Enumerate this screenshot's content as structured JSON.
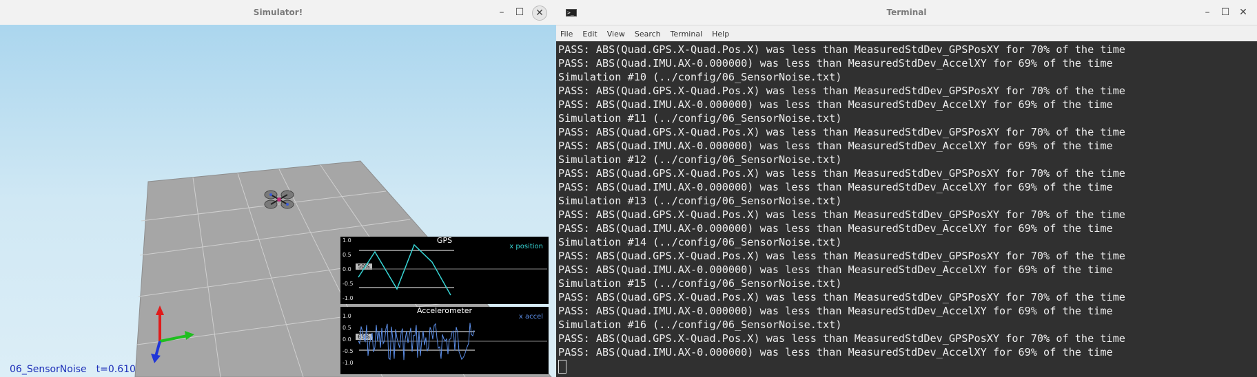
{
  "simulator": {
    "title": "Simulator!",
    "scenario_name": "06_SensorNoise",
    "time_label": "t=0.610",
    "gps_plot": {
      "title": "GPS",
      "legend": "x position",
      "legend_color": "#37d4d4",
      "badge": "50%",
      "yticks": [
        "1.0",
        "0.5",
        "0.0",
        "-0.5",
        "-1.0"
      ]
    },
    "accel_plot": {
      "title": "Accelerometer",
      "legend": "x accel",
      "legend_color": "#5b8ee8",
      "badge": "65%",
      "yticks": [
        "1.0",
        "0.5",
        "0.0",
        "-0.5",
        "-1.0"
      ]
    }
  },
  "terminal": {
    "title": "Terminal",
    "menu": [
      "File",
      "Edit",
      "View",
      "Search",
      "Terminal",
      "Help"
    ],
    "lines": [
      "PASS: ABS(Quad.GPS.X-Quad.Pos.X) was less than MeasuredStdDev_GPSPosXY for 70% of the time",
      "PASS: ABS(Quad.IMU.AX-0.000000) was less than MeasuredStdDev_AccelXY for 69% of the time",
      "Simulation #10 (../config/06_SensorNoise.txt)",
      "PASS: ABS(Quad.GPS.X-Quad.Pos.X) was less than MeasuredStdDev_GPSPosXY for 70% of the time",
      "PASS: ABS(Quad.IMU.AX-0.000000) was less than MeasuredStdDev_AccelXY for 69% of the time",
      "Simulation #11 (../config/06_SensorNoise.txt)",
      "PASS: ABS(Quad.GPS.X-Quad.Pos.X) was less than MeasuredStdDev_GPSPosXY for 70% of the time",
      "PASS: ABS(Quad.IMU.AX-0.000000) was less than MeasuredStdDev_AccelXY for 69% of the time",
      "Simulation #12 (../config/06_SensorNoise.txt)",
      "PASS: ABS(Quad.GPS.X-Quad.Pos.X) was less than MeasuredStdDev_GPSPosXY for 70% of the time",
      "PASS: ABS(Quad.IMU.AX-0.000000) was less than MeasuredStdDev_AccelXY for 69% of the time",
      "Simulation #13 (../config/06_SensorNoise.txt)",
      "PASS: ABS(Quad.GPS.X-Quad.Pos.X) was less than MeasuredStdDev_GPSPosXY for 70% of the time",
      "PASS: ABS(Quad.IMU.AX-0.000000) was less than MeasuredStdDev_AccelXY for 69% of the time",
      "Simulation #14 (../config/06_SensorNoise.txt)",
      "PASS: ABS(Quad.GPS.X-Quad.Pos.X) was less than MeasuredStdDev_GPSPosXY for 70% of the time",
      "PASS: ABS(Quad.IMU.AX-0.000000) was less than MeasuredStdDev_AccelXY for 69% of the time",
      "Simulation #15 (../config/06_SensorNoise.txt)",
      "PASS: ABS(Quad.GPS.X-Quad.Pos.X) was less than MeasuredStdDev_GPSPosXY for 70% of the time",
      "PASS: ABS(Quad.IMU.AX-0.000000) was less than MeasuredStdDev_AccelXY for 69% of the time",
      "Simulation #16 (../config/06_SensorNoise.txt)",
      "PASS: ABS(Quad.GPS.X-Quad.Pos.X) was less than MeasuredStdDev_GPSPosXY for 70% of the time",
      "PASS: ABS(Quad.IMU.AX-0.000000) was less than MeasuredStdDev_AccelXY for 69% of the time"
    ]
  }
}
